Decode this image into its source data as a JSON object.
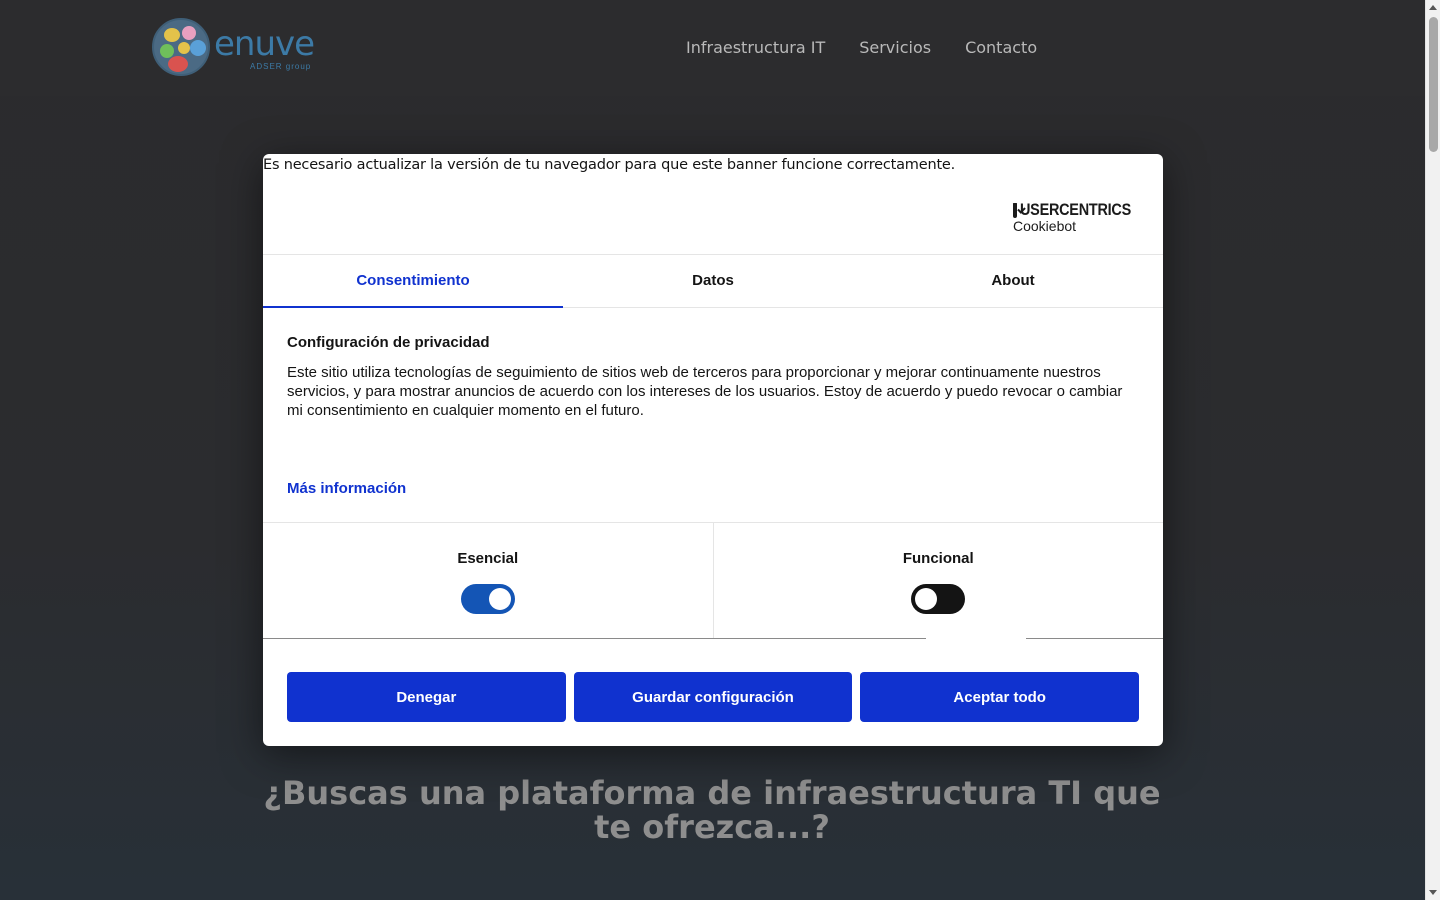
{
  "site": {
    "logo": {
      "word": "enuve",
      "sub": "ADSER group",
      "colors": [
        "#e3c24a",
        "#d9534f",
        "#6fbf5b",
        "#e8a0c0",
        "#5aa0d8",
        "#c94a4a"
      ]
    },
    "nav": [
      {
        "label": "Infraestructura IT"
      },
      {
        "label": "Servicios"
      },
      {
        "label": "Contacto"
      }
    ],
    "hero_heading": "¿Buscas una plataforma de infraestructura TI que te ofrezca...?"
  },
  "dialog": {
    "update_note": "Es necesario actualizar la versión de tu navegador para que este banner funcione correctamente.",
    "brand": {
      "name": "USERCENTRICS",
      "sub": "Cookiebot"
    },
    "tabs": [
      {
        "label": "Consentimiento",
        "active": true
      },
      {
        "label": "Datos",
        "active": false
      },
      {
        "label": "About",
        "active": false
      }
    ],
    "title": "Configuración de privacidad",
    "body": "Este sitio utiliza tecnologías de seguimiento de sitios web de terceros para proporcionar y mejorar continuamente nuestros servicios, y para mostrar anuncios de acuerdo con los intereses de los usuarios. Estoy de acuerdo y puedo revocar o cambiar mi consentimiento en cualquier momento en el futuro.",
    "more_info": "Más información",
    "toggles": [
      {
        "label": "Esencial",
        "on": true
      },
      {
        "label": "Funcional",
        "on": false
      }
    ],
    "buttons": {
      "deny": "Denegar",
      "save": "Guardar configuración",
      "accept": "Aceptar todo"
    }
  },
  "colors": {
    "accent": "#1032cf",
    "toggle_on": "#1455b5",
    "toggle_off": "#141414"
  }
}
